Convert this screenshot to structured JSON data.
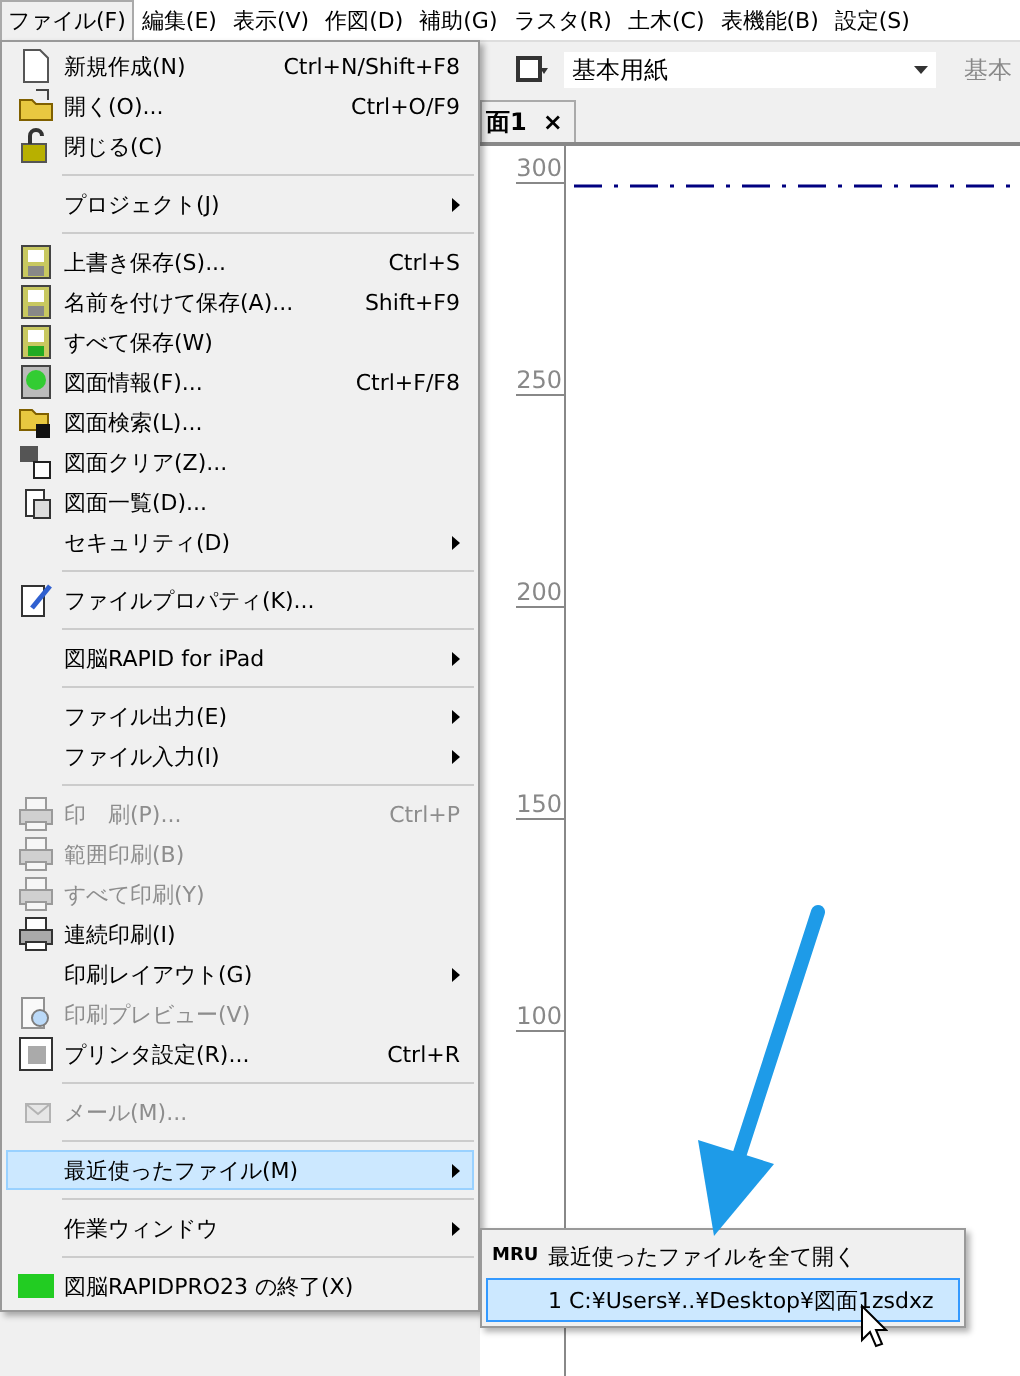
{
  "menubar": [
    {
      "label": "ファイル(F)",
      "selected": true
    },
    {
      "label": "編集(E)",
      "selected": false
    },
    {
      "label": "表示(V)",
      "selected": false
    },
    {
      "label": "作図(D)",
      "selected": false
    },
    {
      "label": "補助(G)",
      "selected": false
    },
    {
      "label": "ラスタ(R)",
      "selected": false
    },
    {
      "label": "土木(C)",
      "selected": false
    },
    {
      "label": "表機能(B)",
      "selected": false
    },
    {
      "label": "設定(S)",
      "selected": false
    }
  ],
  "toolbar": {
    "paper_combo": "基本用紙",
    "label": "基本"
  },
  "tab": {
    "label": "面1",
    "close": "×"
  },
  "ruler": [
    "300",
    "250",
    "200",
    "150",
    "100"
  ],
  "file_menu": [
    {
      "kind": "item",
      "label": "新規作成(N)",
      "shortcut": "Ctrl+N/Shift+F8",
      "submenu": false,
      "disabled": false,
      "selected": false
    },
    {
      "kind": "item",
      "label": "開く(O)...",
      "shortcut": "Ctrl+O/F9",
      "submenu": false,
      "disabled": false,
      "selected": false
    },
    {
      "kind": "item",
      "label": "閉じる(C)",
      "submenu": false,
      "disabled": false,
      "selected": false
    },
    {
      "kind": "separator"
    },
    {
      "kind": "item",
      "label": "プロジェクト(J)",
      "submenu": true,
      "disabled": false,
      "selected": false
    },
    {
      "kind": "separator"
    },
    {
      "kind": "item",
      "label": "上書き保存(S)...",
      "shortcut": "Ctrl+S",
      "submenu": false,
      "disabled": false,
      "selected": false
    },
    {
      "kind": "item",
      "label": "名前を付けて保存(A)...",
      "shortcut": "Shift+F9",
      "submenu": false,
      "disabled": false,
      "selected": false
    },
    {
      "kind": "item",
      "label": "すべて保存(W)",
      "submenu": false,
      "disabled": false,
      "selected": false
    },
    {
      "kind": "item",
      "label": "図面情報(F)...",
      "shortcut": "Ctrl+F/F8",
      "submenu": false,
      "disabled": false,
      "selected": false
    },
    {
      "kind": "item",
      "label": "図面検索(L)...",
      "submenu": false,
      "disabled": false,
      "selected": false
    },
    {
      "kind": "item",
      "label": "図面クリア(Z)...",
      "submenu": false,
      "disabled": false,
      "selected": false
    },
    {
      "kind": "item",
      "label": "図面一覧(D)...",
      "submenu": false,
      "disabled": false,
      "selected": false
    },
    {
      "kind": "item",
      "label": "セキュリティ(D)",
      "submenu": true,
      "disabled": false,
      "selected": false
    },
    {
      "kind": "separator"
    },
    {
      "kind": "item",
      "label": "ファイルプロパティ(K)...",
      "submenu": false,
      "disabled": false,
      "selected": false
    },
    {
      "kind": "separator"
    },
    {
      "kind": "item",
      "label": "図脳RAPID for iPad",
      "submenu": true,
      "disabled": false,
      "selected": false
    },
    {
      "kind": "separator"
    },
    {
      "kind": "item",
      "label": "ファイル出力(E)",
      "submenu": true,
      "disabled": false,
      "selected": false
    },
    {
      "kind": "item",
      "label": "ファイル入力(I)",
      "submenu": true,
      "disabled": false,
      "selected": false
    },
    {
      "kind": "separator"
    },
    {
      "kind": "item",
      "label": "印　刷(P)...",
      "shortcut": "Ctrl+P",
      "submenu": false,
      "disabled": true,
      "selected": false
    },
    {
      "kind": "item",
      "label": "範囲印刷(B)",
      "submenu": false,
      "disabled": true,
      "selected": false
    },
    {
      "kind": "item",
      "label": "すべて印刷(Y)",
      "submenu": false,
      "disabled": true,
      "selected": false
    },
    {
      "kind": "item",
      "label": "連続印刷(I)",
      "submenu": false,
      "disabled": false,
      "selected": false
    },
    {
      "kind": "item",
      "label": "印刷レイアウト(G)",
      "submenu": true,
      "disabled": false,
      "selected": false
    },
    {
      "kind": "item",
      "label": "印刷プレビュー(V)",
      "submenu": false,
      "disabled": true,
      "selected": false
    },
    {
      "kind": "item",
      "label": "プリンタ設定(R)...",
      "shortcut": "Ctrl+R",
      "submenu": false,
      "disabled": false,
      "selected": false
    },
    {
      "kind": "separator"
    },
    {
      "kind": "item",
      "label": "メール(M)...",
      "submenu": false,
      "disabled": true,
      "selected": false
    },
    {
      "kind": "separator"
    },
    {
      "kind": "item",
      "label": "最近使ったファイル(M)",
      "submenu": true,
      "disabled": false,
      "selected": true
    },
    {
      "kind": "separator"
    },
    {
      "kind": "item",
      "label": "作業ウィンドウ",
      "submenu": true,
      "disabled": false,
      "selected": false
    },
    {
      "kind": "separator"
    },
    {
      "kind": "item",
      "label": "図脳RAPIDPRO23 の終了(X)",
      "submenu": false,
      "disabled": false,
      "selected": false
    }
  ],
  "recent_submenu": [
    {
      "badge": "MRU",
      "label": "最近使ったファイルを全て開く",
      "selected": false
    },
    {
      "label": "1 C:¥Users¥..¥Desktop¥図面1zsdxz",
      "selected": true
    }
  ]
}
